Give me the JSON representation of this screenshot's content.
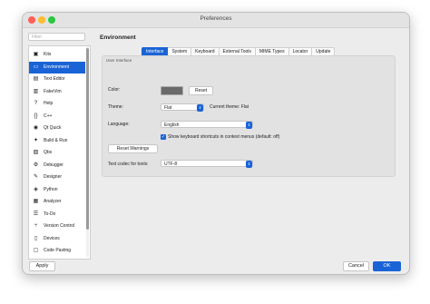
{
  "window": {
    "title": "Preferences"
  },
  "filter": {
    "placeholder": "Filter"
  },
  "sidebar": {
    "items": [
      {
        "label": "Kits",
        "icon": "kits-icon",
        "glyph": "▣"
      },
      {
        "label": "Environment",
        "icon": "environment-icon",
        "glyph": "▭"
      },
      {
        "label": "Text Editor",
        "icon": "text-editor-icon",
        "glyph": "▤"
      },
      {
        "label": "FakeVim",
        "icon": "fakevim-icon",
        "glyph": "▥"
      },
      {
        "label": "Help",
        "icon": "help-icon",
        "glyph": "?"
      },
      {
        "label": "C++",
        "icon": "cpp-icon",
        "glyph": "{}"
      },
      {
        "label": "Qt Quick",
        "icon": "qt-quick-icon",
        "glyph": "◉"
      },
      {
        "label": "Build & Run",
        "icon": "build-run-icon",
        "glyph": "✦"
      },
      {
        "label": "Qbs",
        "icon": "qbs-icon",
        "glyph": "▨"
      },
      {
        "label": "Debugger",
        "icon": "debugger-icon",
        "glyph": "⚙"
      },
      {
        "label": "Designer",
        "icon": "designer-icon",
        "glyph": "✎"
      },
      {
        "label": "Python",
        "icon": "python-icon",
        "glyph": "◈"
      },
      {
        "label": "Analyzer",
        "icon": "analyzer-icon",
        "glyph": "▦"
      },
      {
        "label": "To-Do",
        "icon": "todo-icon",
        "glyph": "☰"
      },
      {
        "label": "Version Control",
        "icon": "version-control-icon",
        "glyph": "⑂"
      },
      {
        "label": "Devices",
        "icon": "devices-icon",
        "glyph": "▯"
      },
      {
        "label": "Code Pasting",
        "icon": "code-pasting-icon",
        "glyph": "▢"
      }
    ],
    "selected_index": 1
  },
  "main": {
    "section_title": "Environment",
    "tabs": [
      {
        "label": "Interface",
        "active": true
      },
      {
        "label": "System",
        "active": false
      },
      {
        "label": "Keyboard",
        "active": false
      },
      {
        "label": "External Tools",
        "active": false
      },
      {
        "label": "MIME Types",
        "active": false
      },
      {
        "label": "Locator",
        "active": false
      },
      {
        "label": "Update",
        "active": false
      }
    ],
    "group_title": "User Interface",
    "color_label": "Color:",
    "reset_label": "Reset",
    "theme_label": "Theme:",
    "theme_value": "Flat",
    "current_theme": "Current theme: Flat",
    "language_label": "Language:",
    "language_value": "English",
    "shortcuts_checkbox": "Show keyboard shortcuts in context menus (default: off)",
    "shortcuts_checked": true,
    "reset_warnings": "Reset Warnings",
    "codec_label": "Text codec for tools:",
    "codec_value": "UTF-8"
  },
  "footer": {
    "apply": "Apply",
    "cancel": "Cancel",
    "ok": "OK"
  },
  "colors": {
    "accent": "#1a63d6",
    "swatch": "#6a6a6a"
  }
}
